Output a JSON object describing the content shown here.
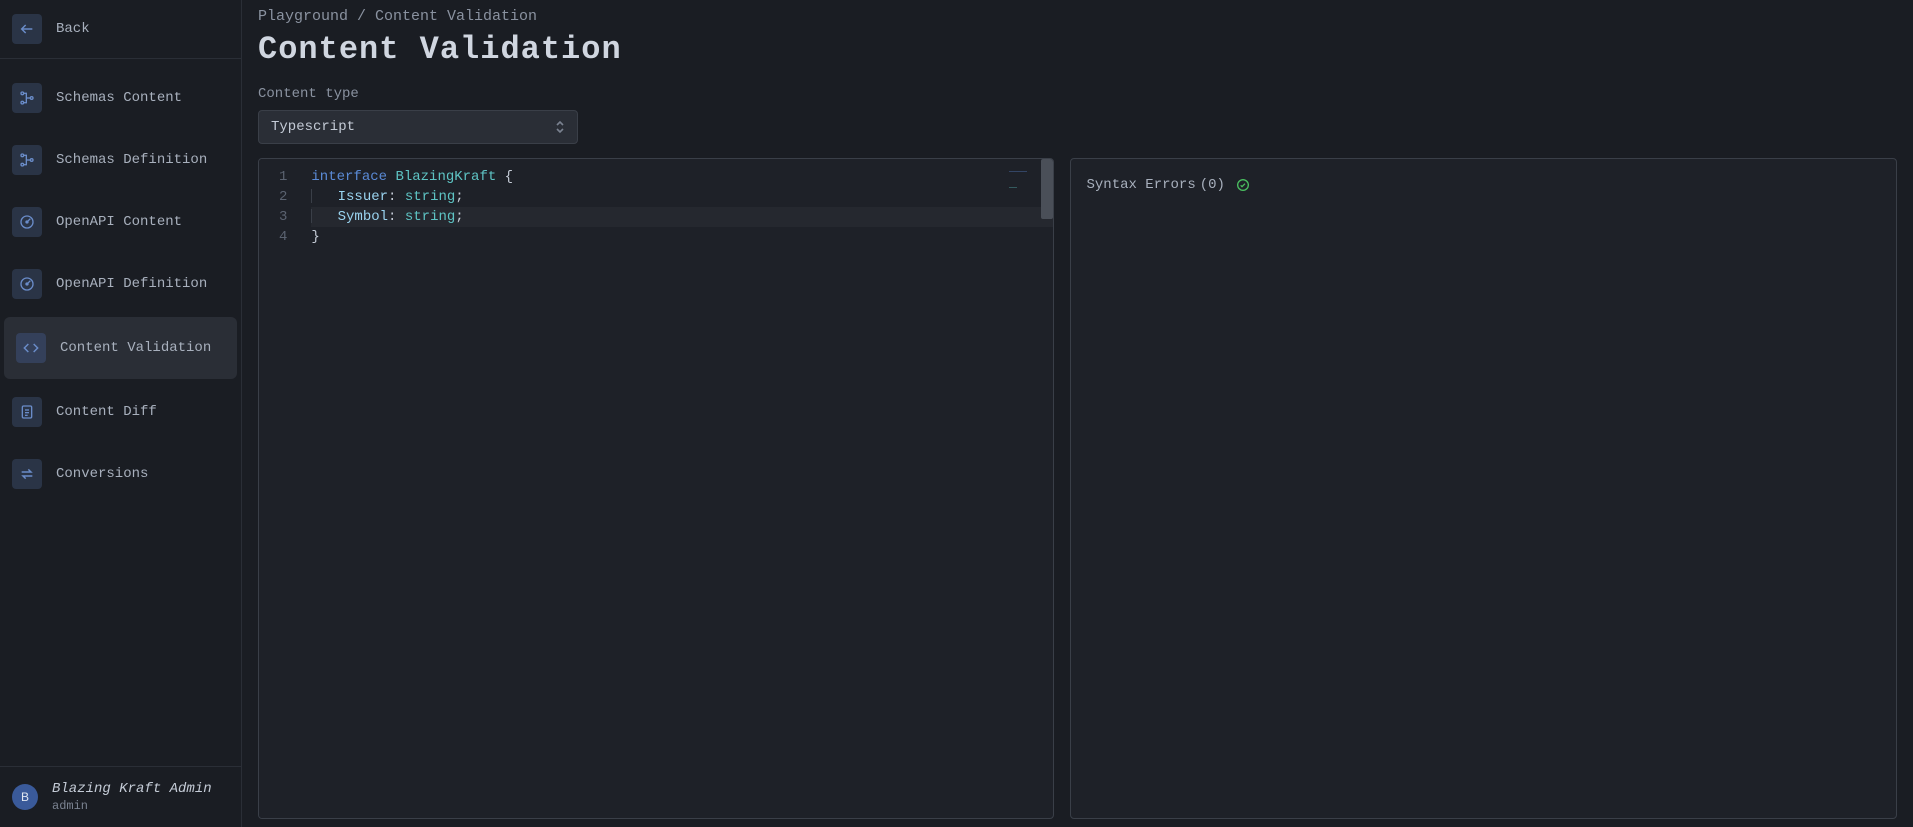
{
  "sidebar": {
    "back_label": "Back",
    "items": [
      {
        "label": "Schemas Content"
      },
      {
        "label": "Schemas Definition"
      },
      {
        "label": "OpenAPI Content"
      },
      {
        "label": "OpenAPI Definition"
      },
      {
        "label": "Content Validation"
      },
      {
        "label": "Content Diff"
      },
      {
        "label": "Conversions"
      }
    ]
  },
  "user": {
    "avatar_letter": "B",
    "name": "Blazing Kraft Admin",
    "role": "admin"
  },
  "breadcrumb": {
    "root": "Playground",
    "sep": " / ",
    "current": "Content Validation"
  },
  "page_title": "Content Validation",
  "content_type_label": "Content type",
  "content_type_value": "Typescript",
  "editor": {
    "line_numbers": [
      "1",
      "2",
      "3",
      "4"
    ],
    "lines": [
      {
        "tokens": [
          {
            "t": "interface",
            "c": "kw"
          },
          {
            "t": " ",
            "c": ""
          },
          {
            "t": "BlazingKraft",
            "c": "typename"
          },
          {
            "t": " ",
            "c": ""
          },
          {
            "t": "{",
            "c": "punct"
          }
        ]
      },
      {
        "indent": 1,
        "tokens": [
          {
            "t": "Issuer",
            "c": "prop"
          },
          {
            "t": ":",
            "c": "punct"
          },
          {
            "t": " ",
            "c": ""
          },
          {
            "t": "string",
            "c": "type"
          },
          {
            "t": ";",
            "c": "punct"
          }
        ]
      },
      {
        "indent": 1,
        "tokens": [
          {
            "t": "Symbol",
            "c": "prop"
          },
          {
            "t": ":",
            "c": "punct"
          },
          {
            "t": " ",
            "c": ""
          },
          {
            "t": "string",
            "c": "type"
          },
          {
            "t": ";",
            "c": "punct"
          }
        ],
        "cursor": true
      },
      {
        "tokens": [
          {
            "t": "}",
            "c": "punct"
          }
        ]
      }
    ]
  },
  "errors": {
    "label": "Syntax Errors",
    "count_text": "(0)"
  }
}
